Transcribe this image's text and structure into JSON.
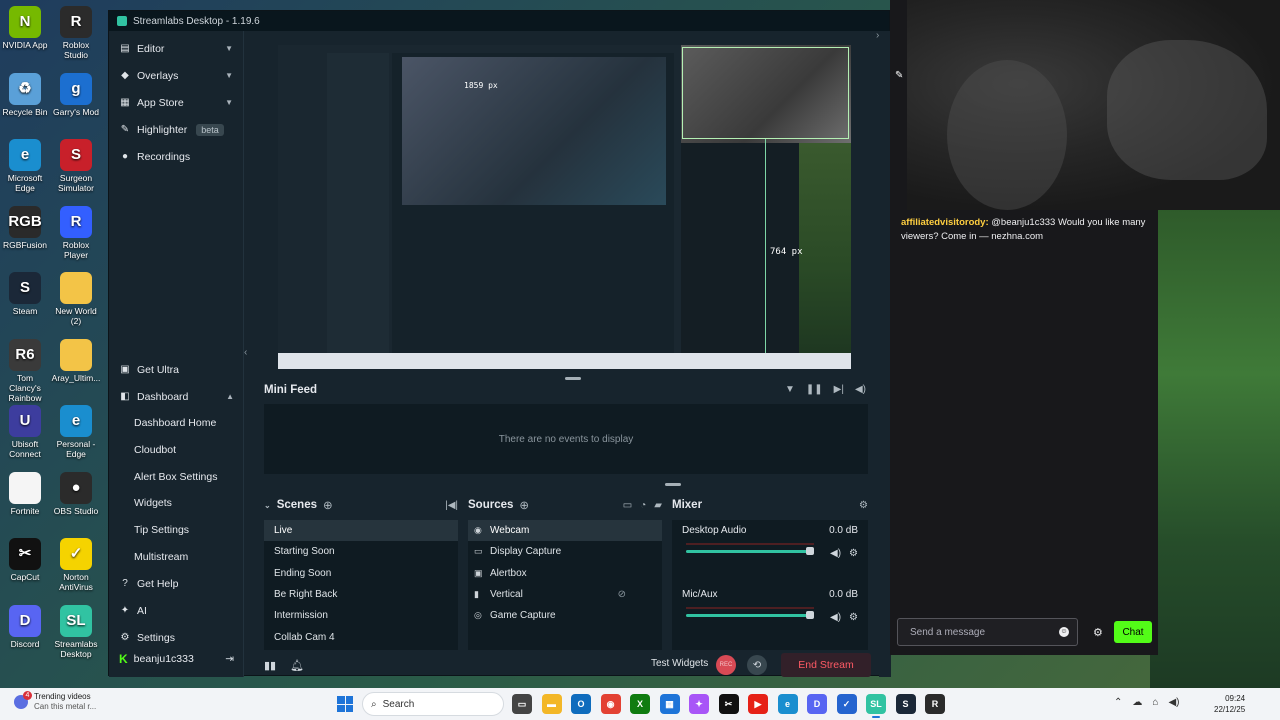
{
  "desktop": {
    "icons": [
      {
        "label": "NVIDIA App",
        "color": "#76b900",
        "glyph": "N"
      },
      {
        "label": "Roblox Studio",
        "color": "#2b2b2b",
        "glyph": "R"
      },
      {
        "label": "Recycle Bin",
        "color": "#5aa0d8",
        "glyph": "♻"
      },
      {
        "label": "Garry's Mod",
        "color": "#1c6fd0",
        "glyph": "g"
      },
      {
        "label": "Microsoft Edge",
        "color": "#1a8ecf",
        "glyph": "e"
      },
      {
        "label": "Surgeon Simulator",
        "color": "#c8202a",
        "glyph": "S"
      },
      {
        "label": "RGBFusion",
        "color": "#2a2a2a",
        "glyph": "RGB"
      },
      {
        "label": "Roblox Player",
        "color": "#335fff",
        "glyph": "R"
      },
      {
        "label": "Steam",
        "color": "#1b2838",
        "glyph": "S"
      },
      {
        "label": "New World (2)",
        "color": "#f3c447",
        "glyph": ""
      },
      {
        "label": "Tom Clancy's Rainbow Si...",
        "color": "#3a3a3a",
        "glyph": "R6"
      },
      {
        "label": "Aray_Ultim...",
        "color": "#f3c447",
        "glyph": ""
      },
      {
        "label": "Ubisoft Connect",
        "color": "#3d3d9e",
        "glyph": "U"
      },
      {
        "label": "Personal - Edge",
        "color": "#1a8ecf",
        "glyph": "e"
      },
      {
        "label": "Fortnite",
        "color": "#f5f5f5",
        "glyph": ""
      },
      {
        "label": "OBS Studio",
        "color": "#2b2b2b",
        "glyph": "●"
      },
      {
        "label": "CapCut",
        "color": "#111111",
        "glyph": "✂"
      },
      {
        "label": "Norton AntiVirus",
        "color": "#f5d300",
        "glyph": "✓"
      },
      {
        "label": "Discord",
        "color": "#5865f2",
        "glyph": "D"
      },
      {
        "label": "Streamlabs Desktop",
        "color": "#31c3a2",
        "glyph": "SL"
      }
    ]
  },
  "window": {
    "title": "Streamlabs Desktop - 1.19.6"
  },
  "sidebar": {
    "items": [
      {
        "label": "Editor",
        "icon": "editor-icon",
        "glyph": "▤",
        "chevron": "▼"
      },
      {
        "label": "Overlays",
        "icon": "overlays-icon",
        "glyph": "◆",
        "chevron": "▼"
      },
      {
        "label": "App Store",
        "icon": "app-store-icon",
        "glyph": "▦",
        "chevron": "▼"
      },
      {
        "label": "Highlighter",
        "icon": "highlighter-icon",
        "glyph": "✎",
        "badge": "beta"
      },
      {
        "label": "Recordings",
        "icon": "recordings-icon",
        "glyph": "●"
      }
    ],
    "lower": [
      {
        "label": "Get Ultra",
        "icon": "ultra-icon",
        "glyph": "▣"
      },
      {
        "label": "Dashboard",
        "icon": "dashboard-icon",
        "glyph": "◧",
        "chevron": "▲"
      }
    ],
    "dashboard_sub": [
      "Dashboard Home",
      "Cloudbot",
      "Alert Box Settings",
      "Widgets",
      "Tip Settings",
      "Multistream"
    ],
    "bottom": [
      {
        "label": "Get Help",
        "icon": "help-icon",
        "glyph": "?"
      },
      {
        "label": "AI",
        "icon": "ai-icon",
        "glyph": "✦"
      },
      {
        "label": "Settings",
        "icon": "settings-icon",
        "glyph": "⚙"
      }
    ],
    "account": {
      "name": "beanju1c333",
      "platform_glyph": "K",
      "logout_glyph": "⇥"
    }
  },
  "preview": {
    "px_label": "764 px",
    "px_label_small": "1859 px"
  },
  "mini_feed": {
    "title": "Mini Feed",
    "empty_text": "There are no events to display"
  },
  "scenes": {
    "title": "Scenes",
    "items": [
      "Live",
      "Starting Soon",
      "Ending Soon",
      "Be Right Back",
      "Intermission",
      "Collab Cam 4"
    ],
    "active": "Live"
  },
  "sources": {
    "title": "Sources",
    "items": [
      {
        "label": "Webcam",
        "glyph": "◉"
      },
      {
        "label": "Display Capture",
        "glyph": "▭"
      },
      {
        "label": "Alertbox",
        "glyph": "▣"
      },
      {
        "label": "Vertical",
        "glyph": "▮"
      },
      {
        "label": "Game Capture",
        "glyph": "◎"
      }
    ]
  },
  "mixer": {
    "title": "Mixer",
    "channels": [
      {
        "name": "Desktop Audio",
        "db": "0.0 dB",
        "level": 1.0
      },
      {
        "name": "Mic/Aux",
        "db": "0.0 dB",
        "level": 1.0
      }
    ]
  },
  "bottom_bar": {
    "test_widgets": "Test Widgets",
    "rec_label": "REC",
    "end_stream": "End Stream"
  },
  "chat": {
    "message_user": "affiliatedvisitorody:",
    "message_text": "@beanju1c333 Would you like many viewers? Come in — nezhna.com",
    "input_placeholder": "Send a message",
    "send_button": "Chat",
    "accent": "#53fc18"
  },
  "taskbar": {
    "news_title": "Trending videos",
    "news_subtitle": "Can this metal r...",
    "news_badge": "4",
    "search_placeholder": "Search",
    "time": "09:24",
    "date": "22/12/25",
    "apps": [
      {
        "name": "task-view-icon",
        "color": "#444",
        "glyph": "▭"
      },
      {
        "name": "file-explorer-icon",
        "color": "#f3b727",
        "glyph": "▬"
      },
      {
        "name": "outlook-icon",
        "color": "#0f6cbd",
        "glyph": "O"
      },
      {
        "name": "chrome-icon",
        "color": "#e34133",
        "glyph": "◉"
      },
      {
        "name": "xbox-icon",
        "color": "#107c10",
        "glyph": "X"
      },
      {
        "name": "store-icon",
        "color": "#1e74d8",
        "glyph": "▦"
      },
      {
        "name": "copilot-icon",
        "color": "#a855f7",
        "glyph": "✦"
      },
      {
        "name": "capcut-icon",
        "color": "#111",
        "glyph": "✂"
      },
      {
        "name": "youtube-icon",
        "color": "#e62117",
        "glyph": "▶"
      },
      {
        "name": "edge-icon",
        "color": "#1a8ecf",
        "glyph": "e"
      },
      {
        "name": "discord-icon",
        "color": "#5865f2",
        "glyph": "D"
      },
      {
        "name": "todo-icon",
        "color": "#2564cf",
        "glyph": "✓"
      },
      {
        "name": "streamlabs-icon",
        "color": "#31c3a2",
        "glyph": "SL",
        "active": true
      },
      {
        "name": "steam-icon",
        "color": "#1b2838",
        "glyph": "S"
      },
      {
        "name": "roblox-icon",
        "color": "#2b2b2b",
        "glyph": "R"
      }
    ]
  }
}
